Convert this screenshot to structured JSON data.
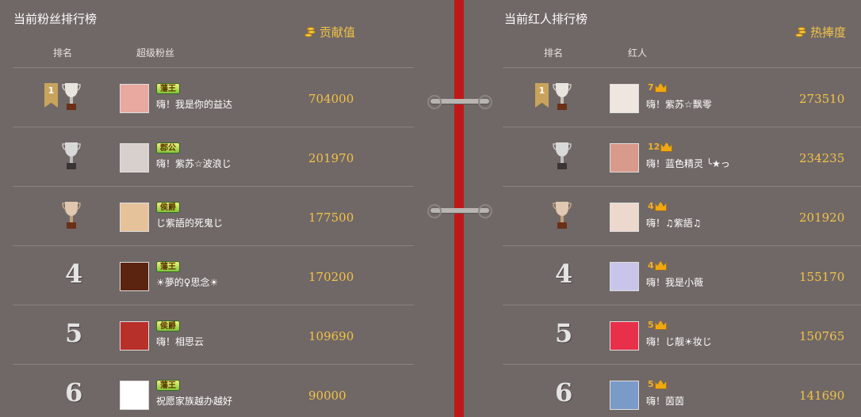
{
  "fans_panel": {
    "title": "当前粉丝排行榜",
    "col_rank": "排名",
    "col_name": "超级粉丝",
    "col_value": "贡献值",
    "rows": [
      {
        "rank": "1",
        "badge": "藩王",
        "name": "嗨！我是你的益达",
        "value": "704000",
        "avatar_color": "#e9a8a0"
      },
      {
        "rank": "2",
        "badge": "郡公",
        "name": "嗨！紫苏☆波浪じ",
        "value": "201970",
        "avatar_color": "#d8d0cc"
      },
      {
        "rank": "3",
        "badge": "侯爵",
        "name": "じ紫語的死鬼じ",
        "value": "177500",
        "avatar_color": "#e6c29a"
      },
      {
        "rank": "4",
        "badge": "藩王",
        "name": "☀夢的♀思念☀",
        "value": "170200",
        "avatar_color": "#5a2410"
      },
      {
        "rank": "5",
        "badge": "侯爵",
        "name": "嗨！相思云",
        "value": "109690",
        "avatar_color": "#b8302a"
      },
      {
        "rank": "6",
        "badge": "藩王",
        "name": "祝愿家族越办越好",
        "value": "90000",
        "avatar_color": "#ffffff"
      }
    ]
  },
  "stars_panel": {
    "title": "当前红人排行榜",
    "col_rank": "排名",
    "col_name": "红人",
    "col_value": "热捧度",
    "rows": [
      {
        "rank": "1",
        "level": "7",
        "name": "嗨！紫苏☆飘零",
        "value": "273510",
        "avatar_color": "#f0e6e0"
      },
      {
        "rank": "2",
        "level": "12",
        "name": "嗨！蓝色精灵 ╰★っ",
        "value": "234235",
        "avatar_color": "#d89a8a"
      },
      {
        "rank": "3",
        "level": "4",
        "name": "嗨！♫紫語♫",
        "value": "201920",
        "avatar_color": "#ecd8cc"
      },
      {
        "rank": "4",
        "level": "4",
        "name": "嗨！我是小薇",
        "value": "155170",
        "avatar_color": "#c8c4ea"
      },
      {
        "rank": "5",
        "level": "5",
        "name": "嗨！じ靓☀妆じ",
        "value": "150765",
        "avatar_color": "#e8304a"
      },
      {
        "rank": "6",
        "level": "5",
        "name": "嗨！茵茵",
        "value": "141690",
        "avatar_color": "#7a9ac8"
      }
    ]
  }
}
